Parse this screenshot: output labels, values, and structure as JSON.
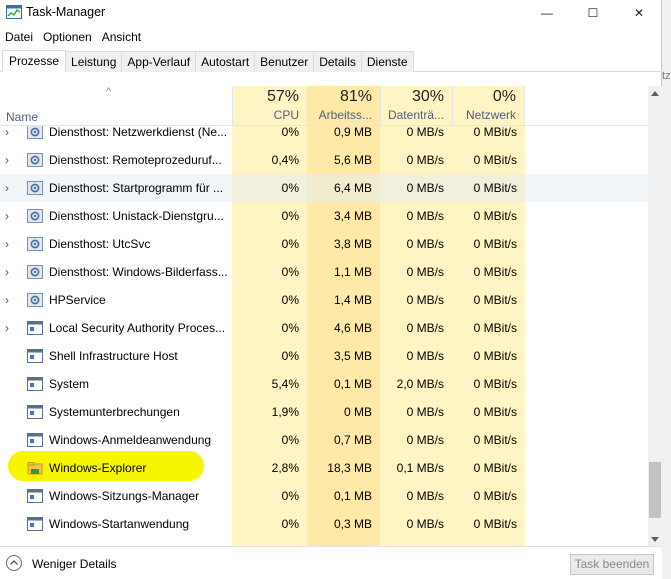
{
  "window": {
    "title": "Task-Manager",
    "minimize_glyph": "—",
    "maximize_glyph": "☐",
    "close_glyph": "✕"
  },
  "menu": [
    "Datei",
    "Optionen",
    "Ansicht"
  ],
  "tabs": [
    {
      "label": "Prozesse",
      "active": true
    },
    {
      "label": "Leistung",
      "active": false
    },
    {
      "label": "App-Verlauf",
      "active": false
    },
    {
      "label": "Autostart",
      "active": false
    },
    {
      "label": "Benutzer",
      "active": false
    },
    {
      "label": "Details",
      "active": false
    },
    {
      "label": "Dienste",
      "active": false
    }
  ],
  "columns": {
    "name": {
      "label": "Name"
    },
    "cpu": {
      "pct": "57%",
      "label": "CPU"
    },
    "memory": {
      "pct": "81%",
      "label": "Arbeitss..."
    },
    "disk": {
      "pct": "30%",
      "label": "Datenträ..."
    },
    "network": {
      "pct": "0%",
      "label": "Netzwerk"
    }
  },
  "rows": [
    {
      "expandable": true,
      "icon": "gear-icon",
      "name": "Diensthost: Netzwerkdienst (Ne...",
      "cpu": "0%",
      "mem": "0,9 MB",
      "disk": "0 MB/s",
      "net": "0 MBit/s"
    },
    {
      "expandable": true,
      "icon": "gear-icon",
      "name": "Diensthost: Remoteprozeduruf...",
      "cpu": "0,4%",
      "mem": "5,6 MB",
      "disk": "0 MB/s",
      "net": "0 MBit/s"
    },
    {
      "expandable": true,
      "icon": "gear-icon",
      "name": "Diensthost: Startprogramm für ...",
      "cpu": "0%",
      "mem": "6,4 MB",
      "disk": "0 MB/s",
      "net": "0 MBit/s",
      "selected": true
    },
    {
      "expandable": true,
      "icon": "gear-icon",
      "name": "Diensthost: Unistack-Dienstgru...",
      "cpu": "0%",
      "mem": "3,4 MB",
      "disk": "0 MB/s",
      "net": "0 MBit/s"
    },
    {
      "expandable": true,
      "icon": "gear-icon",
      "name": "Diensthost: UtcSvc",
      "cpu": "0%",
      "mem": "3,8 MB",
      "disk": "0 MB/s",
      "net": "0 MBit/s"
    },
    {
      "expandable": true,
      "icon": "gear-icon",
      "name": "Diensthost: Windows-Bilderfass...",
      "cpu": "0%",
      "mem": "1,1 MB",
      "disk": "0 MB/s",
      "net": "0 MBit/s"
    },
    {
      "expandable": true,
      "icon": "gear-icon",
      "name": "HPService",
      "cpu": "0%",
      "mem": "1,4 MB",
      "disk": "0 MB/s",
      "net": "0 MBit/s"
    },
    {
      "expandable": true,
      "icon": "window-icon",
      "name": "Local Security Authority Proces...",
      "cpu": "0%",
      "mem": "4,6 MB",
      "disk": "0 MB/s",
      "net": "0 MBit/s"
    },
    {
      "expandable": false,
      "icon": "window-icon",
      "name": "Shell Infrastructure Host",
      "cpu": "0%",
      "mem": "3,5 MB",
      "disk": "0 MB/s",
      "net": "0 MBit/s"
    },
    {
      "expandable": false,
      "icon": "window-icon",
      "name": "System",
      "cpu": "5,4%",
      "mem": "0,1 MB",
      "disk": "2,0 MB/s",
      "net": "0 MBit/s"
    },
    {
      "expandable": false,
      "icon": "window-icon",
      "name": "Systemunterbrechungen",
      "cpu": "1,9%",
      "mem": "0 MB",
      "disk": "0 MB/s",
      "net": "0 MBit/s"
    },
    {
      "expandable": false,
      "icon": "window-icon",
      "name": "Windows-Anmeldeanwendung",
      "cpu": "0%",
      "mem": "0,7 MB",
      "disk": "0 MB/s",
      "net": "0 MBit/s"
    },
    {
      "expandable": false,
      "icon": "folder-icon",
      "name": "Windows-Explorer",
      "cpu": "2,8%",
      "mem": "18,3 MB",
      "disk": "0,1 MB/s",
      "net": "0 MBit/s"
    },
    {
      "expandable": false,
      "icon": "window-icon",
      "name": "Windows-Sitzungs-Manager",
      "cpu": "0%",
      "mem": "0,1 MB",
      "disk": "0 MB/s",
      "net": "0 MBit/s"
    },
    {
      "expandable": false,
      "icon": "window-icon",
      "name": "Windows-Startanwendung",
      "cpu": "0%",
      "mem": "0,3 MB",
      "disk": "0 MB/s",
      "net": "0 MBit/s"
    }
  ],
  "footer": {
    "less_details": "Weniger Details",
    "end_task": "Task beenden"
  },
  "background_fragment": "tz"
}
